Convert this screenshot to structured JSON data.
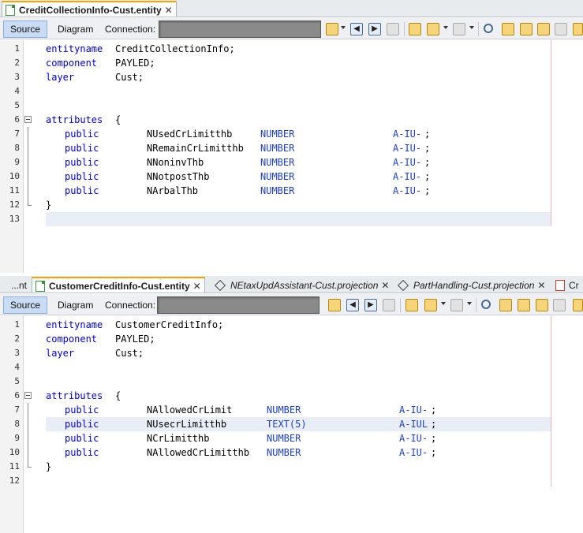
{
  "pane1": {
    "tabs": [
      {
        "label": "CreditCollectionInfo-Cust.entity",
        "close": "✕"
      }
    ],
    "toolbar": {
      "source": "Source",
      "diagram": "Diagram",
      "connection": "Connection:"
    },
    "lines": {
      "l1": {
        "num": "1",
        "kw": "entityname",
        "val": "CreditCollectionInfo;"
      },
      "l2": {
        "num": "2",
        "kw": "component",
        "val": "PAYLED;"
      },
      "l3": {
        "num": "3",
        "kw": "layer",
        "val": "Cust;"
      },
      "l4": {
        "num": "4"
      },
      "l5": {
        "num": "5"
      },
      "l6": {
        "num": "6",
        "kw": "attributes",
        "val": "{"
      },
      "l7": {
        "num": "7",
        "mod": "public",
        "name": "NUsedCrLimitthb",
        "type": "NUMBER",
        "flags": "A-IU-",
        "end": ";"
      },
      "l8": {
        "num": "8",
        "mod": "public",
        "name": "NRemainCrLimitthb",
        "type": "NUMBER",
        "flags": "A-IU-",
        "end": ";"
      },
      "l9": {
        "num": "9",
        "mod": "public",
        "name": "NNoninvThb",
        "type": "NUMBER",
        "flags": "A-IU-",
        "end": ";"
      },
      "l10": {
        "num": "10",
        "mod": "public",
        "name": "NNotpostThb",
        "type": "NUMBER",
        "flags": "A-IU-",
        "end": ";"
      },
      "l11": {
        "num": "11",
        "mod": "public",
        "name": "NArbalThb",
        "type": "NUMBER",
        "flags": "A-IU-",
        "end": ";"
      },
      "l12": {
        "num": "12",
        "val": "}"
      },
      "l13": {
        "num": "13"
      }
    }
  },
  "pane2": {
    "tabs": [
      {
        "label": "...nt"
      },
      {
        "label": "CustomerCreditInfo-Cust.entity",
        "close": "✕"
      },
      {
        "label": "NEtaxUpdAssistant-Cust.projection",
        "close": "✕"
      },
      {
        "label": "PartHandling-Cust.projection",
        "close": "✕"
      },
      {
        "label": "Cr"
      }
    ],
    "toolbar": {
      "source": "Source",
      "diagram": "Diagram",
      "connection": "Connection:"
    },
    "lines": {
      "l1": {
        "num": "1",
        "kw": "entityname",
        "val": "CustomerCreditInfo;"
      },
      "l2": {
        "num": "2",
        "kw": "component",
        "val": "PAYLED;"
      },
      "l3": {
        "num": "3",
        "kw": "layer",
        "val": "Cust;"
      },
      "l4": {
        "num": "4"
      },
      "l5": {
        "num": "5"
      },
      "l6": {
        "num": "6",
        "kw": "attributes",
        "val": "{"
      },
      "l7": {
        "num": "7",
        "mod": "public",
        "name": "NAllowedCrLimit",
        "type": "NUMBER",
        "flags": "A-IU-",
        "end": ";"
      },
      "l8": {
        "num": "8",
        "mod": "public",
        "name": "NUsecrLimitthb",
        "type": "TEXT(5)",
        "flags": "A-IUL",
        "end": ";"
      },
      "l9": {
        "num": "9",
        "mod": "public",
        "name": "NCrLimitthb",
        "type": "NUMBER",
        "flags": "A-IU-",
        "end": ";"
      },
      "l10": {
        "num": "10",
        "mod": "public",
        "name": "NAllowedCrLimitthb",
        "type": "NUMBER",
        "flags": "A-IU-",
        "end": ";"
      },
      "l11": {
        "num": "11",
        "val": "}"
      },
      "l12": {
        "num": "12"
      }
    }
  },
  "colors": {
    "accent": "#f0a30a",
    "keyword": "#0000c8",
    "type": "#1f3fbf",
    "selected_mode": "#c9dcf3"
  },
  "icons": [
    "document-icon",
    "run-icon",
    "back-icon",
    "forward-icon",
    "deploy-icon",
    "find-icon",
    "bookmark-icon",
    "overflow-icon"
  ]
}
